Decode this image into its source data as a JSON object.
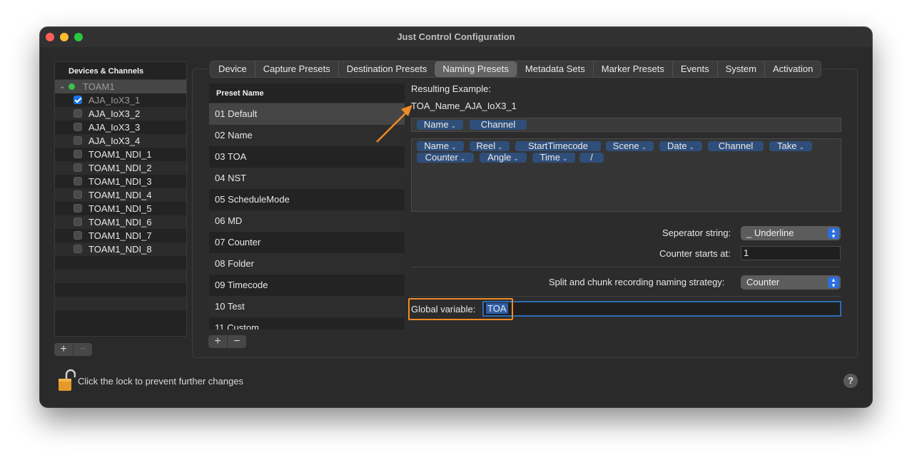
{
  "window": {
    "title": "Just Control Configuration"
  },
  "colors": {
    "accent": "#1a73e8",
    "highlight": "#f08a24",
    "token": "#2f4f7a"
  },
  "devices": {
    "header": "Devices & Channels",
    "group": "TOAM1",
    "items": [
      {
        "label": "AJA_IoX3_1",
        "checked": true
      },
      {
        "label": "AJA_IoX3_2",
        "checked": false
      },
      {
        "label": "AJA_IoX3_3",
        "checked": false
      },
      {
        "label": "AJA_IoX3_4",
        "checked": false
      },
      {
        "label": "TOAM1_NDI_1",
        "checked": false
      },
      {
        "label": "TOAM1_NDI_2",
        "checked": false
      },
      {
        "label": "TOAM1_NDI_3",
        "checked": false
      },
      {
        "label": "TOAM1_NDI_4",
        "checked": false
      },
      {
        "label": "TOAM1_NDI_5",
        "checked": false
      },
      {
        "label": "TOAM1_NDI_6",
        "checked": false
      },
      {
        "label": "TOAM1_NDI_7",
        "checked": false
      },
      {
        "label": "TOAM1_NDI_8",
        "checked": false
      }
    ],
    "add": "+",
    "remove": "−"
  },
  "tabs": [
    "Device",
    "Capture Presets",
    "Destination Presets",
    "Naming Presets",
    "Metadata Sets",
    "Marker Presets",
    "Events",
    "System",
    "Activation"
  ],
  "active_tab": "Naming Presets",
  "presets": {
    "header": "Preset Name",
    "items": [
      "01 Default",
      "02 Name",
      "03 TOA",
      "04 NST",
      "05 ScheduleMode",
      "06 MD",
      "07 Counter",
      "08 Folder",
      "09 Timecode",
      "10 Test",
      "11 Custom"
    ],
    "selected": "01 Default",
    "add": "+",
    "remove": "−"
  },
  "naming": {
    "result_label": "Resulting Example:",
    "result_value": "TOA_Name_AJA_IoX3_1",
    "current_tokens": [
      {
        "label": "Name",
        "menu": true
      },
      {
        "label": "Channel",
        "menu": false
      }
    ],
    "available_tokens": [
      {
        "label": "Name",
        "menu": true
      },
      {
        "label": "Reel",
        "menu": true
      },
      {
        "label": "StartTimecode",
        "menu": false
      },
      {
        "label": "Scene",
        "menu": true
      },
      {
        "label": "Date",
        "menu": true
      },
      {
        "label": "Channel",
        "menu": false
      },
      {
        "label": "Take",
        "menu": true
      },
      {
        "label": "Counter",
        "menu": true
      },
      {
        "label": "Angle",
        "menu": true
      },
      {
        "label": "Time",
        "menu": true
      },
      {
        "label": "/",
        "menu": false
      }
    ],
    "separator_label": "Seperator string:",
    "separator_value": "_ Underline",
    "counter_label": "Counter starts at:",
    "counter_value": "1",
    "split_label": "Split and chunk recording naming strategy:",
    "split_value": "Counter",
    "global_label": "Global variable:",
    "global_value": "TOA"
  },
  "footer": {
    "lock_text": "Click the lock to prevent further changes",
    "help": "?"
  }
}
